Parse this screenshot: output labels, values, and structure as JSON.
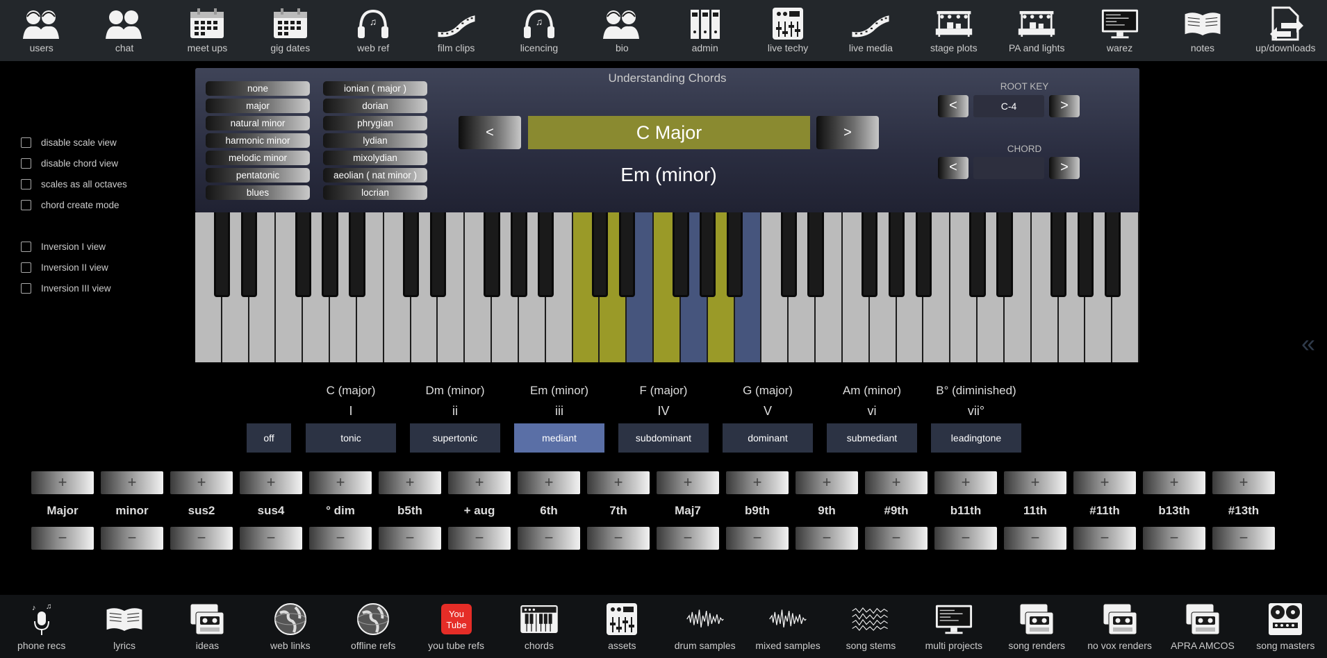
{
  "top_nav": [
    {
      "label": "users",
      "icon": "users-icon"
    },
    {
      "label": "chat",
      "icon": "chat-icon"
    },
    {
      "label": "meet ups",
      "icon": "calendar-icon"
    },
    {
      "label": "gig dates",
      "icon": "calendar-icon"
    },
    {
      "label": "web ref",
      "icon": "headphones-icon"
    },
    {
      "label": "film clips",
      "icon": "film-strip-icon"
    },
    {
      "label": "licencing",
      "icon": "headphones-icon"
    },
    {
      "label": "bio",
      "icon": "users-icon"
    },
    {
      "label": "admin",
      "icon": "binders-icon"
    },
    {
      "label": "live techy",
      "icon": "mixer-icon"
    },
    {
      "label": "live media",
      "icon": "film-strip-icon"
    },
    {
      "label": "stage plots",
      "icon": "stage-icon"
    },
    {
      "label": "PA and lights",
      "icon": "stage-icon"
    },
    {
      "label": "warez",
      "icon": "monitor-icon"
    },
    {
      "label": "notes",
      "icon": "book-icon"
    },
    {
      "label": "up/downloads",
      "icon": "upload-download-icon"
    }
  ],
  "bottom_nav": [
    {
      "label": "phone recs",
      "icon": "microphone-icon"
    },
    {
      "label": "lyrics",
      "icon": "book-icon"
    },
    {
      "label": "ideas",
      "icon": "tape-deck-icon"
    },
    {
      "label": "web links",
      "icon": "globe-icon"
    },
    {
      "label": "offline refs",
      "icon": "globe-icon"
    },
    {
      "label": "you tube refs",
      "icon": "youtube-icon"
    },
    {
      "label": "chords",
      "icon": "keyboard-icon"
    },
    {
      "label": "assets",
      "icon": "mixer-icon"
    },
    {
      "label": "drum samples",
      "icon": "waveform-icon"
    },
    {
      "label": "mixed samples",
      "icon": "waveform-icon"
    },
    {
      "label": "song stems",
      "icon": "stems-icon"
    },
    {
      "label": "multi projects",
      "icon": "monitor-icon"
    },
    {
      "label": "song renders",
      "icon": "tape-deck-icon"
    },
    {
      "label": "no vox renders",
      "icon": "tape-deck-icon"
    },
    {
      "label": "APRA AMCOS",
      "icon": "tape-deck-icon"
    },
    {
      "label": "song masters",
      "icon": "reel-to-reel-icon"
    }
  ],
  "options": {
    "view_toggles": [
      "disable scale view",
      "disable chord view",
      "scales as all octaves",
      "chord create mode"
    ],
    "inversion_toggles": [
      "Inversion I view",
      "Inversion II view",
      "Inversion III view"
    ]
  },
  "panel": {
    "title": "Understanding Chords",
    "scale_types": [
      "none",
      "major",
      "natural minor",
      "harmonic minor",
      "melodic minor",
      "pentatonic",
      "blues"
    ],
    "modes": [
      "ionian ( major )",
      "dorian",
      "phrygian",
      "lydian",
      "mixolydian",
      "aeolian ( nat minor )",
      "locrian"
    ],
    "prev_label": "<",
    "next_label": ">",
    "current_scale": "C Major",
    "current_chord": "Em (minor)",
    "root_key_label": "ROOT KEY",
    "root_key_value": "C-4",
    "chord_label": "CHORD",
    "chord_value": "",
    "small_prev": "<",
    "small_next": ">"
  },
  "keyboard": {
    "white_key_count": 35,
    "black_key_pattern": [
      1,
      1,
      0,
      1,
      1,
      1,
      0
    ],
    "scale_highlight_white": [
      14,
      15,
      17,
      19
    ],
    "chord_highlight_white": [
      16,
      18,
      20
    ],
    "highlight_colors": {
      "scale": "#9a9a28",
      "chord": "#46557d"
    }
  },
  "degrees": {
    "names": [
      "C (major)",
      "Dm (minor)",
      "Em (minor)",
      "F (major)",
      "G (major)",
      "Am (minor)",
      "B° (diminished)"
    ],
    "numerals": [
      "I",
      "ii",
      "iii",
      "IV",
      "V",
      "vi",
      "vii°"
    ],
    "buttons": [
      "off",
      "tonic",
      "supertonic",
      "mediant",
      "subdominant",
      "dominant",
      "submediant",
      "leadingtone"
    ],
    "selected": "mediant",
    "selected_color": "#5a6fa6"
  },
  "extensions": {
    "labels": [
      "Major",
      "minor",
      "sus2",
      "sus4",
      "° dim",
      "b5th",
      "+ aug",
      "6th",
      "7th",
      "Maj7",
      "b9th",
      "9th",
      "#9th",
      "b11th",
      "11th",
      "#11th",
      "b13th",
      "#13th"
    ],
    "plus": "+",
    "minus": "−"
  },
  "collapse_glyph": "«"
}
